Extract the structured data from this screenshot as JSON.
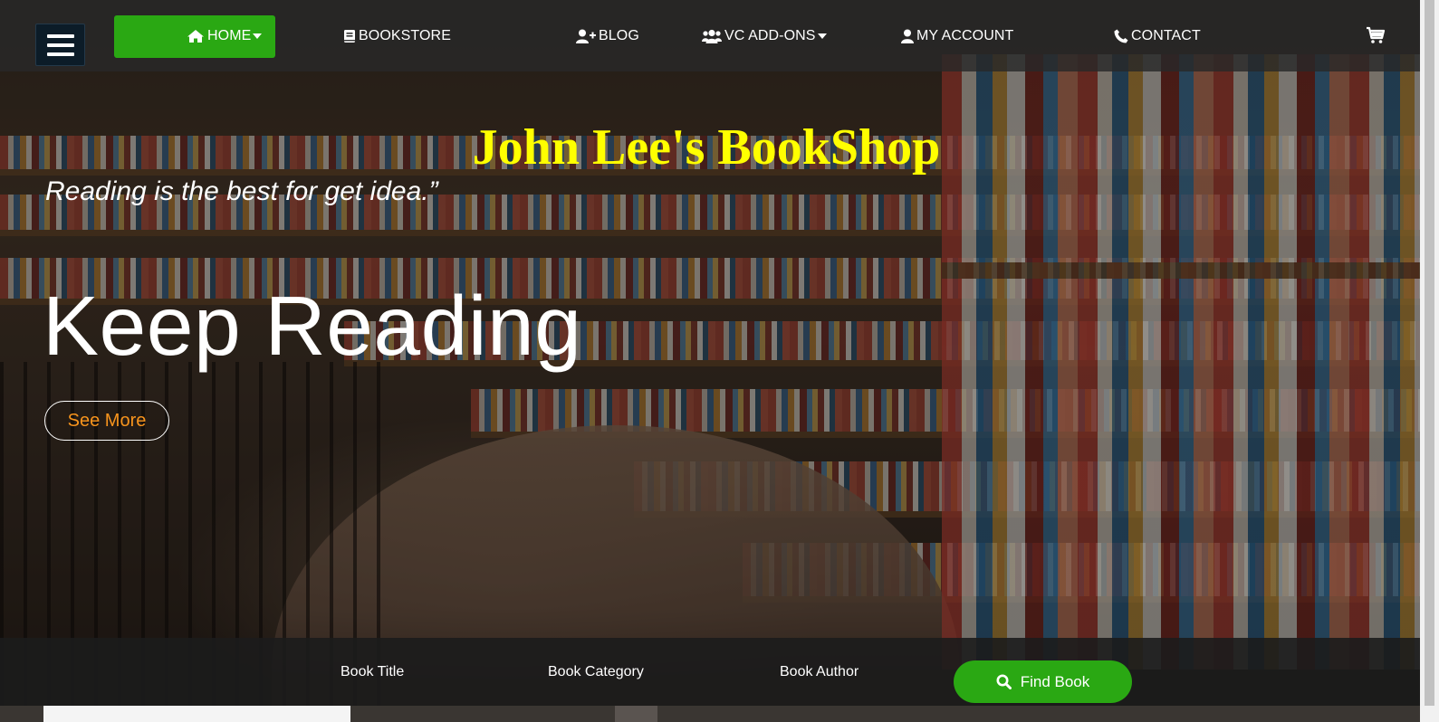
{
  "nav": {
    "items": [
      {
        "label": "HOME",
        "icon": "home-icon",
        "has_dropdown": true,
        "active": true
      },
      {
        "label": "BOOKSTORE",
        "icon": "book-icon",
        "has_dropdown": false
      },
      {
        "label": "BLOG",
        "icon": "user-plus-icon",
        "has_dropdown": false
      },
      {
        "label": "VC ADD-ONS",
        "icon": "users-icon",
        "has_dropdown": true
      },
      {
        "label": "MY ACCOUNT",
        "icon": "user-icon",
        "has_dropdown": false
      },
      {
        "label": "CONTACT",
        "icon": "phone-icon",
        "has_dropdown": false
      }
    ],
    "menu_icon": "hamburger-menu-icon",
    "cart_icon": "shopping-cart-icon",
    "active_color": "#2aa813"
  },
  "hero": {
    "site_title": "John Lee's BookShop",
    "tagline": "Reading is the best for get idea.”",
    "headline": "Keep Reading",
    "cta_label": "See More",
    "title_color": "#ffff00",
    "cta_color": "#f7941d"
  },
  "search": {
    "fields": [
      "Book Title",
      "Book Category",
      "Book Author"
    ],
    "button_label": "Find Book",
    "button_icon": "search-icon",
    "button_color": "#2aa813"
  }
}
